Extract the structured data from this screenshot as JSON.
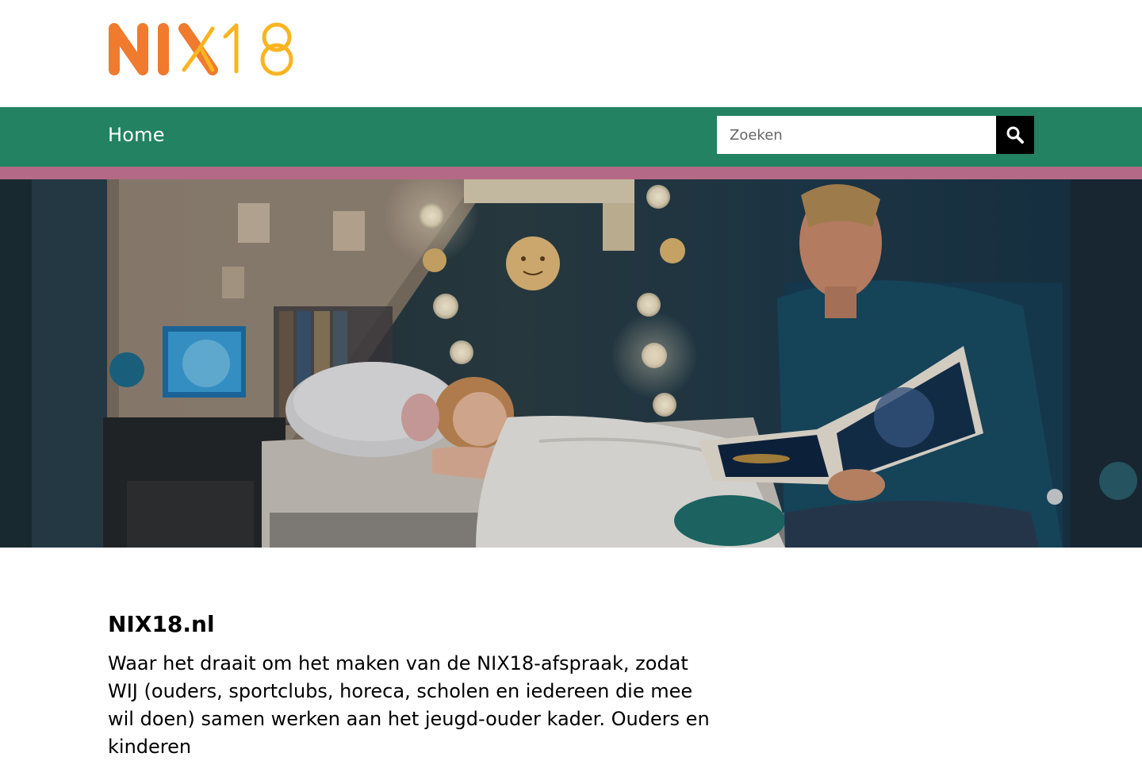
{
  "brand": {
    "logo_text": "NIX18",
    "colors": {
      "orange": "#f07a2e",
      "yellow": "#f9b421"
    }
  },
  "nav": {
    "home_label": "Home",
    "background": "#228262",
    "accent_bar": "#b46a86"
  },
  "search": {
    "placeholder": "Zoeken",
    "value": "",
    "icon": "search-icon"
  },
  "hero": {
    "alt": "Vader leest voor aan dochter in bed"
  },
  "main": {
    "title": "NIX18.nl",
    "intro": "Waar het draait om het maken van de NIX18-afspraak, zodat WIJ (ouders, sportclubs, horeca, scholen en iedereen die mee wil doen) samen werken aan het jeugd-ouder kader. Ouders en kinderen"
  }
}
